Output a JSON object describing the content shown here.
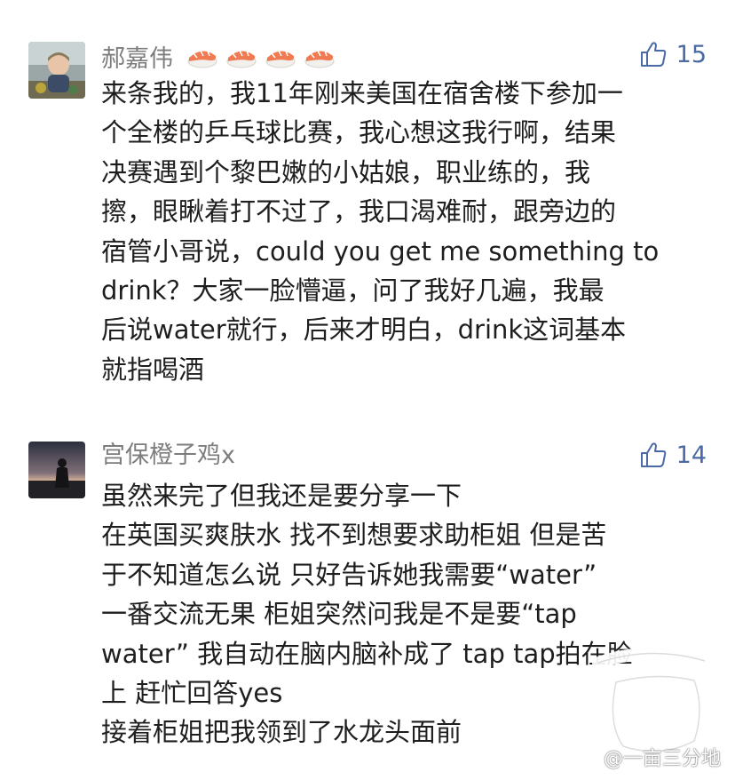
{
  "comments": [
    {
      "username": "郝嘉伟",
      "badge_icons": [
        "sushi-icon",
        "sushi-icon",
        "sushi-icon",
        "sushi-icon"
      ],
      "like_icon": "thumbs-up-icon",
      "like_count": "15",
      "lines": [
        "来条我的，我11年刚来美国在宿舍楼下参加一",
        "个全楼的乒乓球比赛，我心想这我行啊，结果",
        "决赛遇到个黎巴嫩的小姑娘，职业练的，我",
        "擦，眼瞅着打不过了，我口渴难耐，跟旁边的",
        "宿管小哥说，could you get me something to",
        "drink？大家一脸懵逼，问了我好几遍，我最",
        "后说water就行，后来才明白，drink这词基本",
        "就指喝酒"
      ]
    },
    {
      "username": "宫保橙子鸡x",
      "like_icon": "thumbs-up-icon",
      "like_count": "14",
      "lines": [
        "虽然来完了但我还是要分享一下",
        "在英国买爽肤水 找不到想要求助柜姐 但是苦",
        "于不知道怎么说 只好告诉她我需要“water”",
        "一番交流无果  柜姐突然问我是不是要“tap",
        "water” 我自动在脑内脑补成了  tap tap拍在脸",
        "上 赶忙回答yes",
        "接着柜姐把我领到了水龙头面前"
      ]
    }
  ],
  "watermark": {
    "text": "@一亩三分地",
    "logo_icon": "field-logo-icon"
  },
  "colors": {
    "username": "#7d7d7d",
    "like": "#4a6aa5",
    "body_text": "#1e1e1e",
    "background": "#ffffff"
  }
}
